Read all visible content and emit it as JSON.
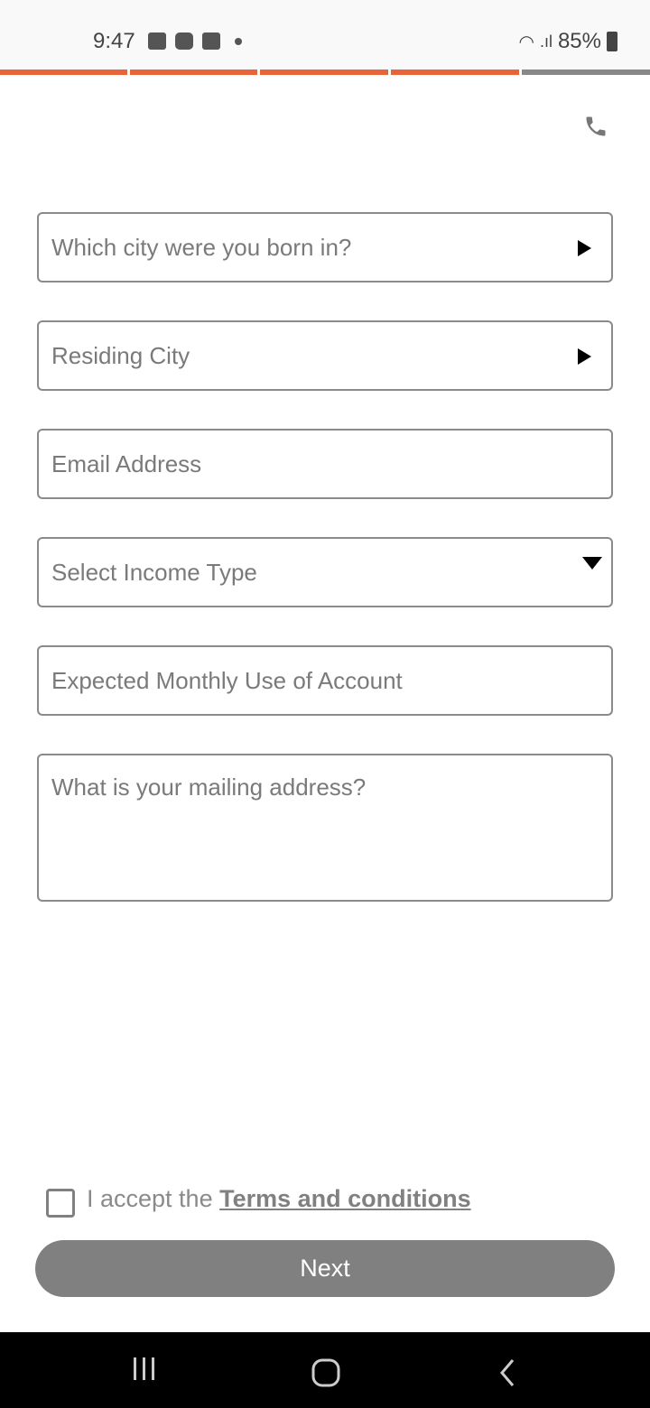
{
  "status_bar": {
    "time": "9:47",
    "battery": "85%"
  },
  "progress": {
    "steps_total": 5,
    "steps_completed": 4,
    "active_color": "#E8623A",
    "inactive_color": "#888888"
  },
  "form": {
    "birth_city": {
      "placeholder": "Which city were you born in?"
    },
    "residing_city": {
      "placeholder": "Residing City"
    },
    "email": {
      "placeholder": "Email Address"
    },
    "income_type": {
      "placeholder": "Select Income Type"
    },
    "monthly_use": {
      "placeholder": "Expected Monthly Use of Account"
    },
    "mailing_address": {
      "placeholder": "What is your mailing address?"
    }
  },
  "terms": {
    "prefix": "I accept the ",
    "link": "Terms and conditions"
  },
  "next_label": "Next"
}
